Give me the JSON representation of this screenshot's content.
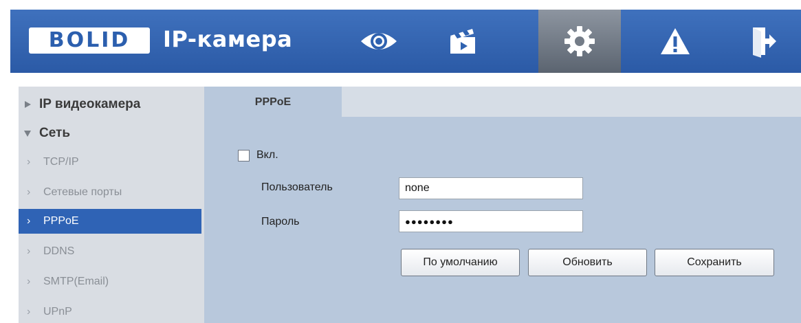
{
  "header": {
    "logo_text": "BOLID",
    "title": "IP-камера",
    "nav": [
      {
        "icon": "eye-icon",
        "active": false
      },
      {
        "icon": "clapperboard-icon",
        "active": false
      },
      {
        "icon": "gear-icon",
        "active": true
      },
      {
        "icon": "warning-icon",
        "active": false
      },
      {
        "icon": "logout-icon",
        "active": false
      }
    ]
  },
  "sidebar": {
    "items": [
      {
        "label": "IP видеокамера",
        "level": 0,
        "expanded": false
      },
      {
        "label": "Сеть",
        "level": 0,
        "expanded": true
      },
      {
        "label": "TCP/IP",
        "level": 1
      },
      {
        "label": "Сетевые порты",
        "level": 1
      },
      {
        "label": "PPPoE",
        "level": 1,
        "selected": true
      },
      {
        "label": "DDNS",
        "level": 1
      },
      {
        "label": "SMTP(Email)",
        "level": 1
      },
      {
        "label": "UPnP",
        "level": 1
      }
    ]
  },
  "main": {
    "tab": "PPPoE",
    "enable_label": "Вкл.",
    "enable_checked": false,
    "user_label": "Пользователь",
    "user_value": "none",
    "password_label": "Пароль",
    "password_value": "●●●●●●●●",
    "buttons": {
      "default": "По умолчанию",
      "refresh": "Обновить",
      "save": "Сохранить"
    }
  },
  "colors": {
    "header": "#2f62b0",
    "selected": "#2f63b5",
    "content_bg": "#b8c8dc",
    "sidebar_bg": "#d9dde3"
  }
}
